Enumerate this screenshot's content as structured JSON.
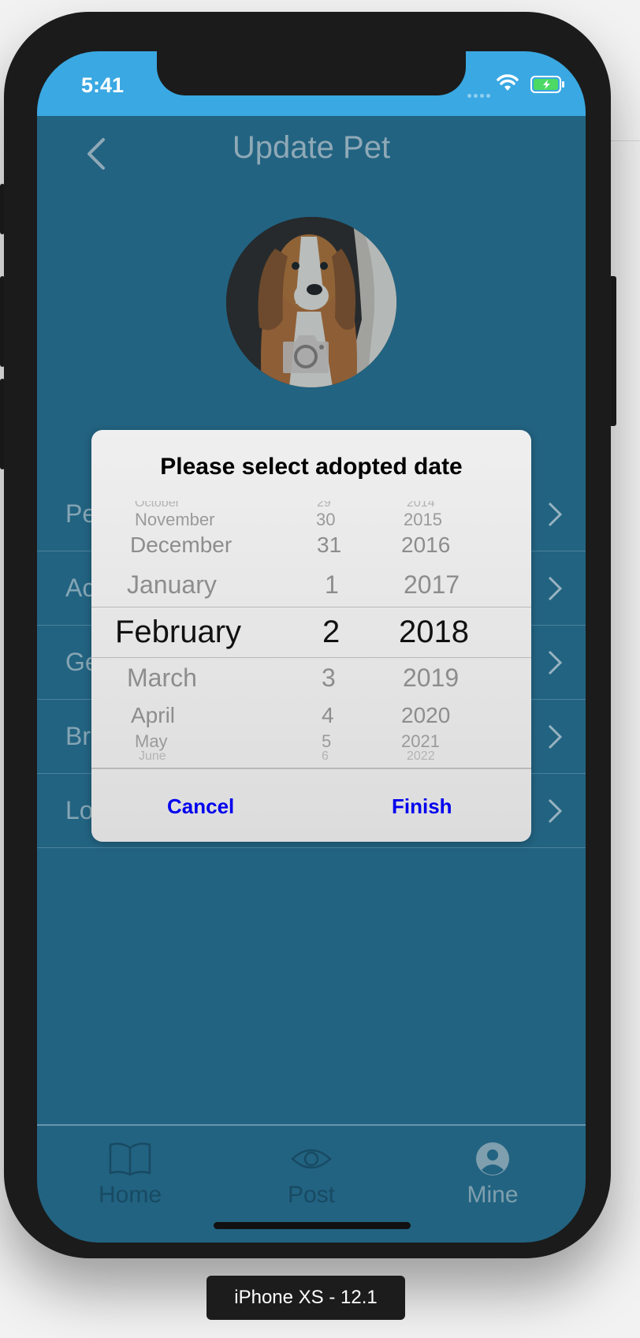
{
  "status_bar": {
    "time": "5:41"
  },
  "nav": {
    "title": "Update Pet"
  },
  "rows": [
    {
      "label": "Pe"
    },
    {
      "label": "Ac"
    },
    {
      "label": "Ge"
    },
    {
      "label": "Br"
    },
    {
      "label": "Lo"
    }
  ],
  "dialog": {
    "title": "Please select adopted date",
    "months": [
      "October",
      "November",
      "December",
      "January",
      "February",
      "March",
      "April",
      "May",
      "June"
    ],
    "days": [
      "29",
      "30",
      "31",
      "1",
      "2",
      "3",
      "4",
      "5",
      "6"
    ],
    "years": [
      "2014",
      "2015",
      "2016",
      "2017",
      "2018",
      "2019",
      "2020",
      "2021",
      "2022"
    ],
    "selected": {
      "month": "February",
      "day": "2",
      "year": "2018"
    },
    "cancel_label": "Cancel",
    "finish_label": "Finish"
  },
  "tabs": [
    {
      "label": "Home",
      "icon": "book-icon"
    },
    {
      "label": "Post",
      "icon": "eye-icon"
    },
    {
      "label": "Mine",
      "icon": "user-icon",
      "active": true
    }
  ],
  "device_label": "iPhone XS - 12.1",
  "colors": {
    "status_bar": "#3aa8e2",
    "background": "#226381",
    "button_text": "#0000ee"
  }
}
